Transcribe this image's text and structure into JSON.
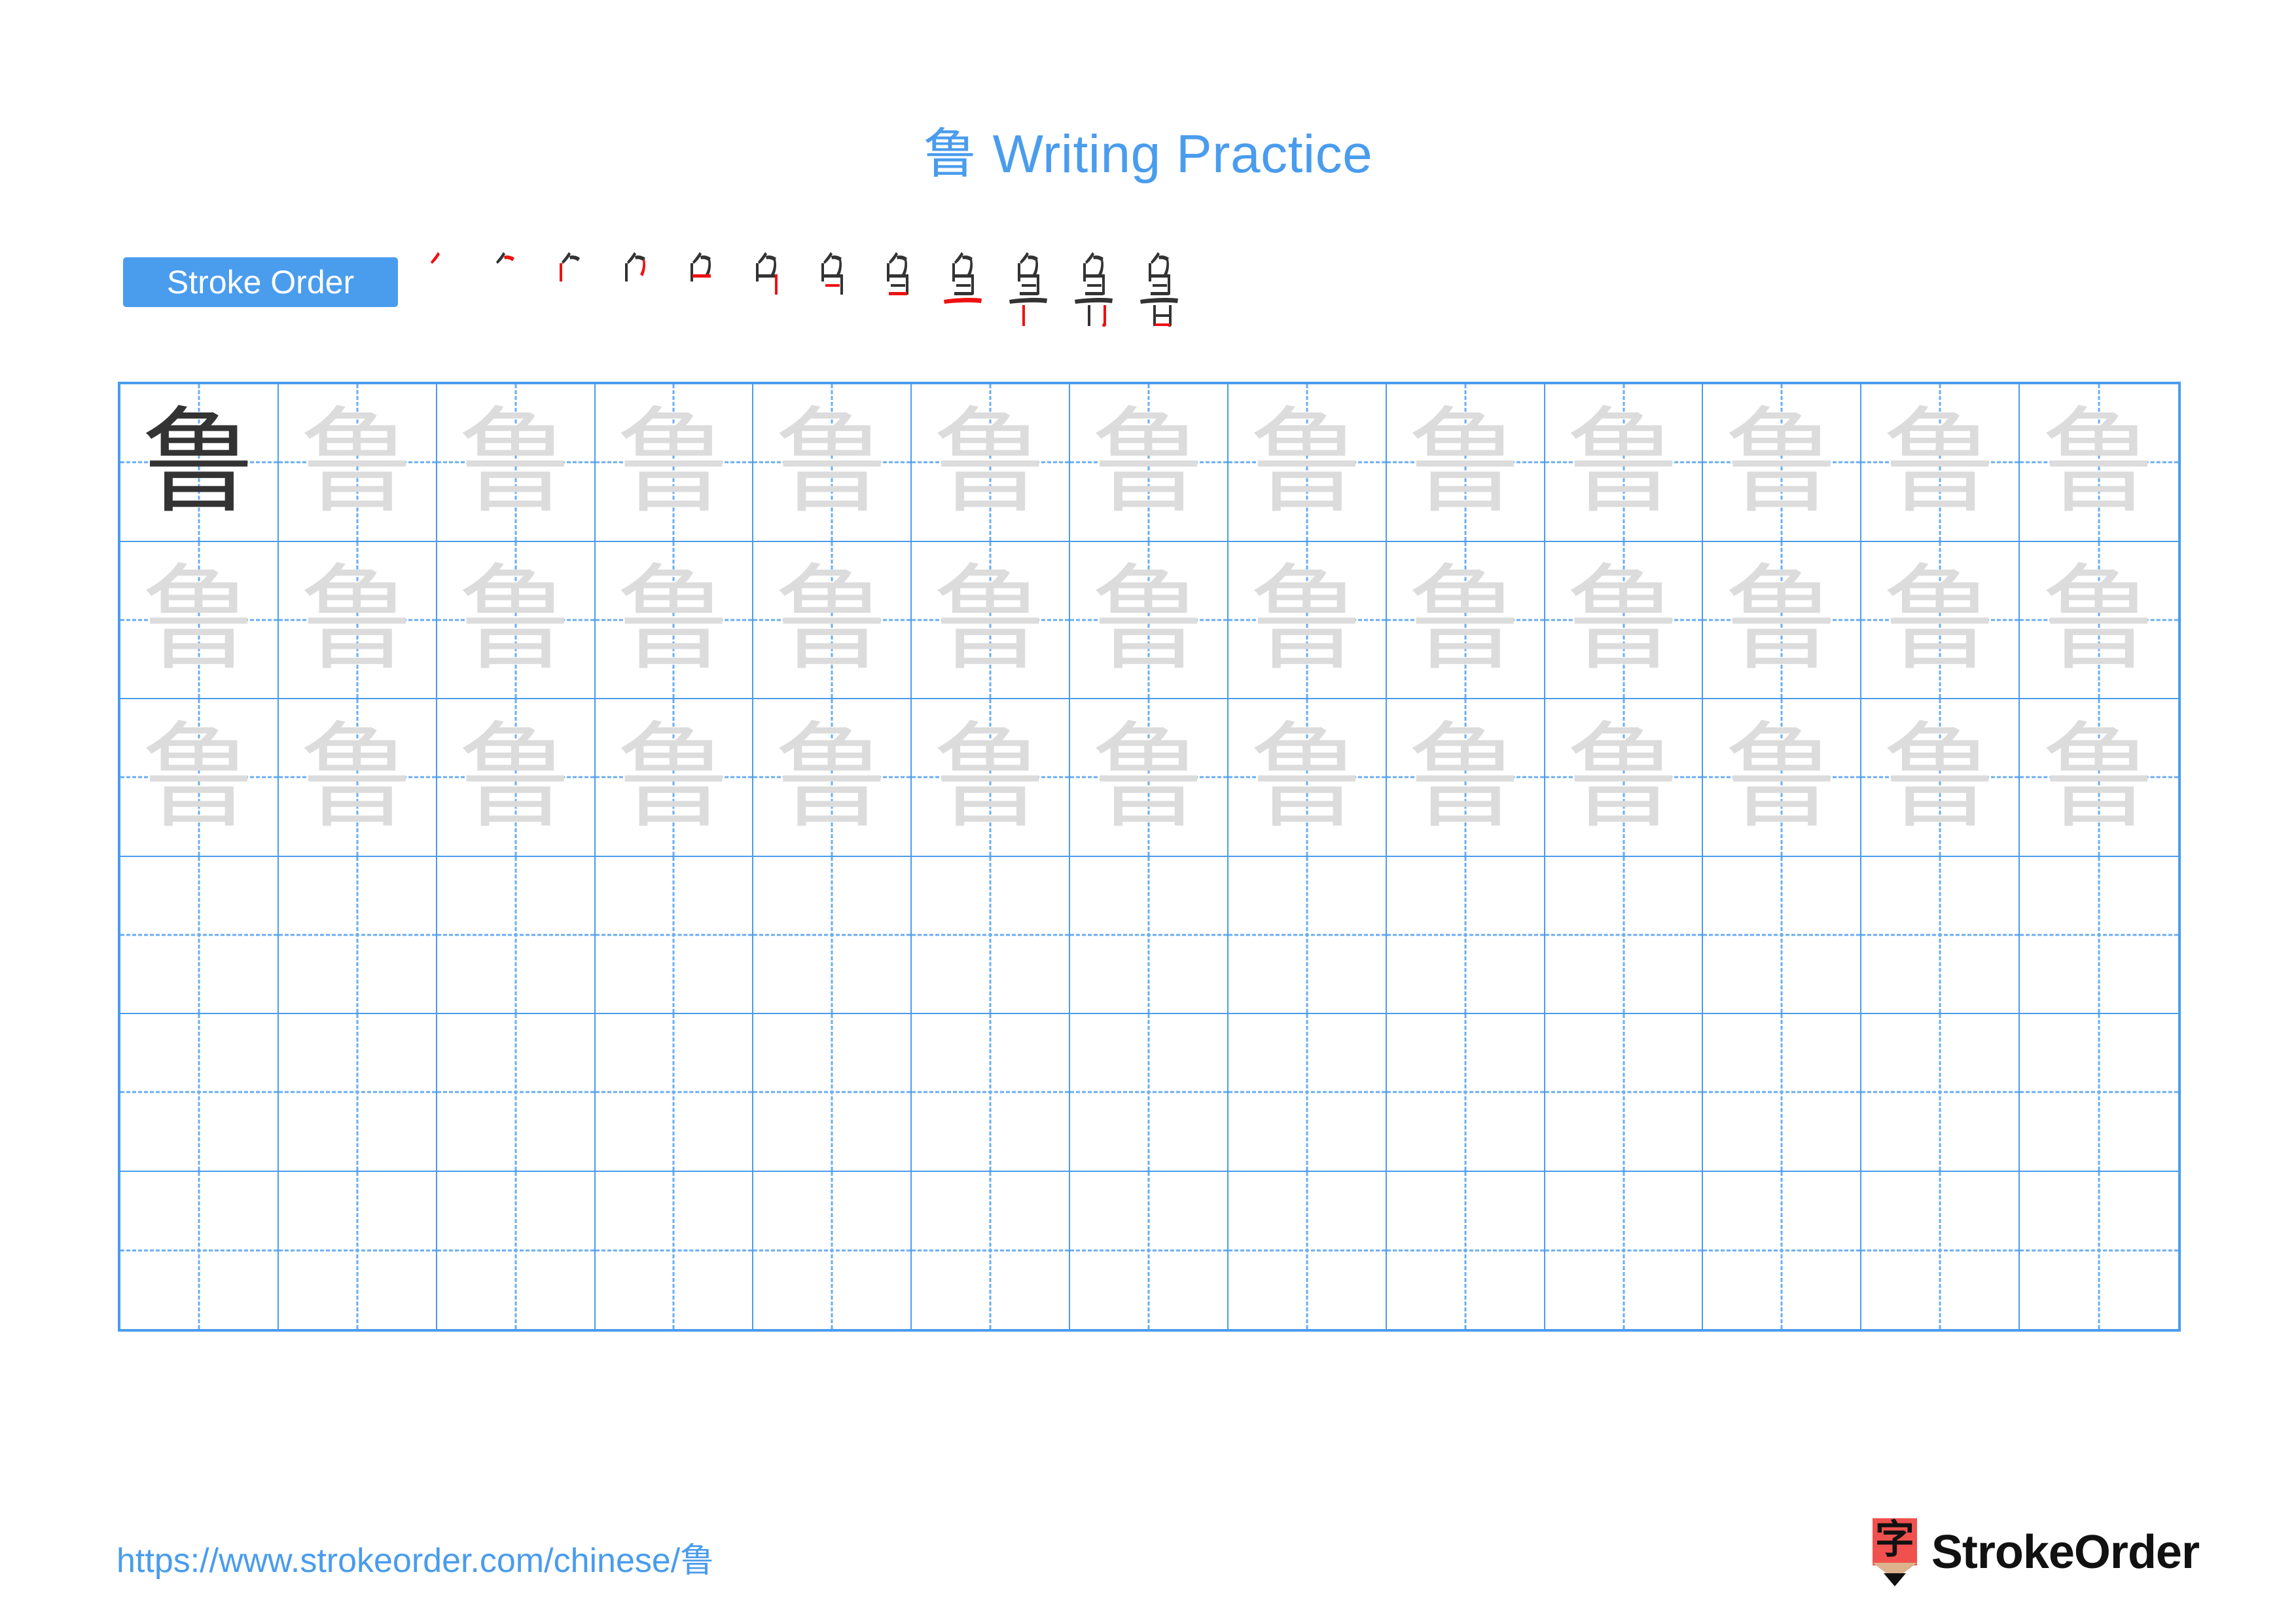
{
  "character": "鲁",
  "title": "鲁 Writing Practice",
  "colors": {
    "accent_blue": "#4a9ced",
    "grid_line": "#4a9ced",
    "guide_dash": "#6aaef2",
    "trace_gray": "#dcdcdc",
    "ink_dark": "#333333",
    "new_stroke_red": "#ee1111",
    "logo_red": "#f0514e",
    "logo_wood": "#dcb38d"
  },
  "stroke_order": {
    "badge_label": "Stroke Order",
    "total_strokes": 12,
    "steps": [
      {
        "index": 1,
        "glyph": "丿",
        "description": "stroke 1 of 12"
      },
      {
        "index": 2,
        "glyph": "⺈",
        "description": "stroke 2 of 12"
      },
      {
        "index": 3,
        "glyph": "𠂊",
        "description": "stroke 3 of 12"
      },
      {
        "index": 4,
        "glyph": "勹",
        "description": "stroke 4 of 12"
      },
      {
        "index": 5,
        "glyph": "刍",
        "description": "stroke 5 of 12"
      },
      {
        "index": 6,
        "glyph": "角",
        "description": "stroke 6 of 12"
      },
      {
        "index": 7,
        "glyph": "龟",
        "description": "stroke 7 of 12"
      },
      {
        "index": 8,
        "glyph": "鱼",
        "description": "stroke 8 of 12"
      },
      {
        "index": 9,
        "glyph": "鱼",
        "description": "stroke 9 of 12"
      },
      {
        "index": 10,
        "glyph": "鲁",
        "description": "stroke 10 of 12"
      },
      {
        "index": 11,
        "glyph": "鲁",
        "description": "stroke 11 of 12"
      },
      {
        "index": 12,
        "glyph": "鲁",
        "description": "stroke 12 of 12"
      }
    ]
  },
  "practice_grid": {
    "columns": 13,
    "rows": 6,
    "rows_data": [
      {
        "row": 1,
        "cells": [
          "dark",
          "trace",
          "trace",
          "trace",
          "trace",
          "trace",
          "trace",
          "trace",
          "trace",
          "trace",
          "trace",
          "trace",
          "trace"
        ]
      },
      {
        "row": 2,
        "cells": [
          "trace",
          "trace",
          "trace",
          "trace",
          "trace",
          "trace",
          "trace",
          "trace",
          "trace",
          "trace",
          "trace",
          "trace",
          "trace"
        ]
      },
      {
        "row": 3,
        "cells": [
          "trace",
          "trace",
          "trace",
          "trace",
          "trace",
          "trace",
          "trace",
          "trace",
          "trace",
          "trace",
          "trace",
          "trace",
          "trace"
        ]
      },
      {
        "row": 4,
        "cells": [
          "empty",
          "empty",
          "empty",
          "empty",
          "empty",
          "empty",
          "empty",
          "empty",
          "empty",
          "empty",
          "empty",
          "empty",
          "empty"
        ]
      },
      {
        "row": 5,
        "cells": [
          "empty",
          "empty",
          "empty",
          "empty",
          "empty",
          "empty",
          "empty",
          "empty",
          "empty",
          "empty",
          "empty",
          "empty",
          "empty"
        ]
      },
      {
        "row": 6,
        "cells": [
          "empty",
          "empty",
          "empty",
          "empty",
          "empty",
          "empty",
          "empty",
          "empty",
          "empty",
          "empty",
          "empty",
          "empty",
          "empty"
        ]
      }
    ]
  },
  "footer": {
    "url": "https://www.strokeorder.com/chinese/鲁",
    "brand_name": "StrokeOrder",
    "logo_glyph": "字"
  }
}
